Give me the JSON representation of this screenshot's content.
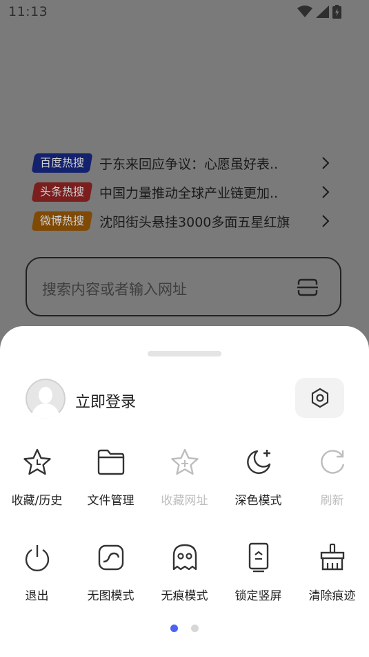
{
  "status_bar": {
    "time": "11:13"
  },
  "hot_search": [
    {
      "source": "百度热搜",
      "title": "于东来回应争议：心愿虽好表..",
      "color": "#14216d"
    },
    {
      "source": "头条热搜",
      "title": "中国力量推动全球产业链更加..",
      "color": "#7a1e1e"
    },
    {
      "source": "微博热搜",
      "title": "沈阳街头悬挂3000多面五星红旗",
      "color": "#7f4a06"
    }
  ],
  "search": {
    "placeholder": "搜索内容或者输入网址"
  },
  "menu_sheet": {
    "login_label": "立即登录",
    "row1": [
      {
        "label": "收藏/历史",
        "icon": "star-icon",
        "enabled": true
      },
      {
        "label": "文件管理",
        "icon": "folder-icon",
        "enabled": true
      },
      {
        "label": "收藏网址",
        "icon": "star-plus-icon",
        "enabled": false
      },
      {
        "label": "深色模式",
        "icon": "moon-icon",
        "enabled": true
      },
      {
        "label": "刷新",
        "icon": "refresh-icon",
        "enabled": false
      }
    ],
    "row2": [
      {
        "label": "退出",
        "icon": "power-icon",
        "enabled": true
      },
      {
        "label": "无图模式",
        "icon": "no-image-icon",
        "enabled": true
      },
      {
        "label": "无痕模式",
        "icon": "ghost-icon",
        "enabled": true
      },
      {
        "label": "锁定竖屏",
        "icon": "portrait-lock-icon",
        "enabled": true
      },
      {
        "label": "清除痕迹",
        "icon": "broom-icon",
        "enabled": true
      }
    ],
    "page_indicator": {
      "current": 1,
      "total": 2
    }
  },
  "colors": {
    "accent": "#4a63f0",
    "overlay": "#7a7a7a",
    "sheet": "#ffffff"
  }
}
